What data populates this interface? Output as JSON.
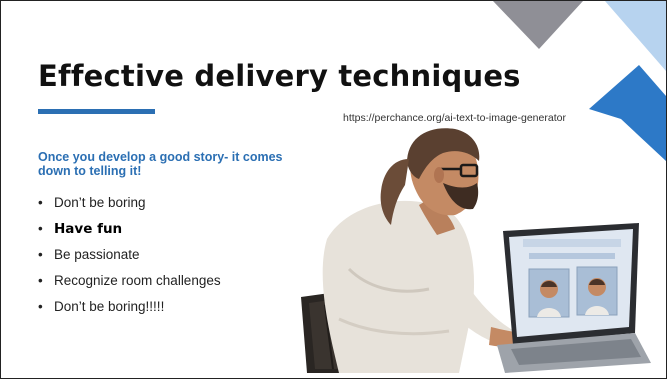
{
  "slide": {
    "title": "Effective delivery techniques",
    "source_url": "https://perchance.org/ai-text-to-image-generator",
    "subheading": "Once you develop a good story- it comes down to telling it!",
    "bullet_glyph": "•",
    "bullets": [
      {
        "text": "Don’t be boring",
        "emphasis": false
      },
      {
        "text": "Have fun",
        "emphasis": true
      },
      {
        "text": "Be passionate",
        "emphasis": false
      },
      {
        "text": "Recognize room challenges",
        "emphasis": false
      },
      {
        "text": "Don’t be boring!!!!!",
        "emphasis": false
      }
    ],
    "illustration": "man-at-laptop-image"
  },
  "colors": {
    "accent": "#2b6fb3",
    "gray_triangle": "#8f8f96",
    "light_blue": "#b7d3ef",
    "blue_band": "#2d79c7",
    "title": "#111111"
  }
}
